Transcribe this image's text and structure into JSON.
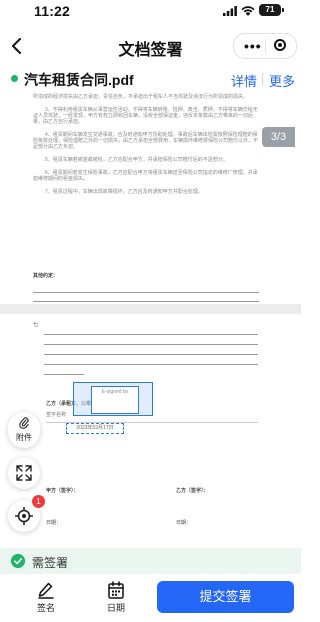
{
  "status_bar": {
    "time": "11:22",
    "battery": "71"
  },
  "nav": {
    "title": "文档签署"
  },
  "file": {
    "name": "汽车租赁合同.pdf",
    "detail_label": "详情",
    "more_label": "更多"
  },
  "page_indicator": "3/3",
  "page1": {
    "paragraphs": [
      "所造成的经济损失由乙方承担，责任自负，不承担出于租车人不当驾驶及违法行为所造成的损失。",
      "3、不得利用租赁车辆从事营运性活动，不得将车辆转租、抵押、典当、质押，不得将车辆交给无证人员驾驶，一经发现，甲方有权立即收回车辆，没收全部保证金，违反本条款由乙方带来的一切后果，由乙方自行承担。",
      "4、租赁期间车辆发生交通事故，应及时通知甲方协助处理。事故后车辆出险需按照保险理赔的保险条款处理，保险理赔之外的一切损失，由乙方承担全部费用，车辆损坏维修费保险公司赔付以外，不足部分由乙方负担。",
      "5、租赁车辆若被盗或被抢，乙方应配合甲方，并承担保险公司赔付后的不足部分。",
      "6、租赁期间若发生保险事故，乙方应配合甲方将租赁车辆送至保险公司指定的维修厂修理，并承担维修期间的租金损失。",
      "7、租赁过程中，车辆出现故障损坏，乙方应及时通知甲方并配合处理。"
    ],
    "other_label": "其他约定："
  },
  "page2": {
    "party_b_title": "乙方（承租方、公章盖章）：",
    "party_b_sub": "签字名称",
    "party_a_label": "甲方（签字）：",
    "party_b_sign_label": "乙方（签字）：",
    "date_label_a": "日期：",
    "date_label_b": "日期：",
    "signed_by": "E-signed by",
    "date_value": "2023年03月17日"
  },
  "fabs": {
    "attachment_label": "附件",
    "badge": "1"
  },
  "need_sign_label": "需签署",
  "toolbar": {
    "sign_label": "签名",
    "date_label": "日期",
    "submit_label": "提交签署"
  },
  "colors": {
    "primary": "#2466f5",
    "green": "#1fb36b",
    "badge_red": "#ee3b3b"
  }
}
